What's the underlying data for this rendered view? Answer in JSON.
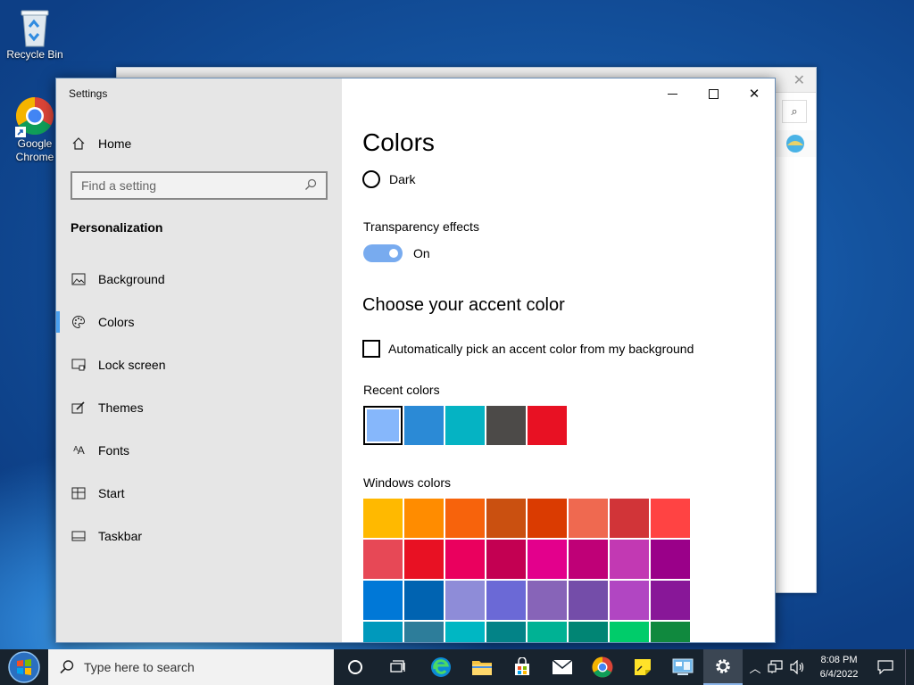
{
  "desktop": {
    "recycle_bin": "Recycle Bin",
    "chrome_line1": "Google",
    "chrome_line2": "Chrome"
  },
  "settings": {
    "title": "Settings",
    "controls": {
      "minimize": "—",
      "maximize": "☐",
      "close": "✕"
    },
    "home": "Home",
    "search_placeholder": "Find a setting",
    "section": "Personalization",
    "nav": [
      {
        "label": "Background",
        "icon": "image-icon"
      },
      {
        "label": "Colors",
        "icon": "palette-icon"
      },
      {
        "label": "Lock screen",
        "icon": "lock-screen-icon"
      },
      {
        "label": "Themes",
        "icon": "themes-icon"
      },
      {
        "label": "Fonts",
        "icon": "fonts-icon"
      },
      {
        "label": "Start",
        "icon": "start-icon"
      },
      {
        "label": "Taskbar",
        "icon": "taskbar-icon"
      }
    ],
    "selected_nav": "Colors"
  },
  "colors_page": {
    "title": "Colors",
    "dark_option": "Dark",
    "transparency_label": "Transparency effects",
    "transparency_state": "On",
    "accent_heading": "Choose your accent color",
    "auto_pick_label": "Automatically pick an accent color from my background",
    "recent_label": "Recent colors",
    "recent_colors": [
      "#86b7fb",
      "#2b8ad6",
      "#05b3c3",
      "#4c4a48",
      "#e81123"
    ],
    "windows_label": "Windows colors",
    "windows_colors": [
      [
        "#ffb900",
        "#ff8c00",
        "#f7630c",
        "#ca5010",
        "#da3b01",
        "#ef6950",
        "#d13438",
        "#ff4343"
      ],
      [
        "#e74856",
        "#e81123",
        "#ea005e",
        "#c30052",
        "#e3008c",
        "#bf0077",
        "#c239b3",
        "#9a0089"
      ],
      [
        "#0078d7",
        "#0063b1",
        "#8e8cd8",
        "#6b69d6",
        "#8764b8",
        "#744da9",
        "#b146c2",
        "#881798"
      ],
      [
        "#0099bc",
        "#2d7d9a",
        "#00b7c3",
        "#038387",
        "#00b294",
        "#018574",
        "#00cc6a",
        "#10893e"
      ]
    ]
  },
  "taskbar": {
    "search_placeholder": "Type here to search",
    "time": "8:08 PM",
    "date": "6/4/2022"
  }
}
